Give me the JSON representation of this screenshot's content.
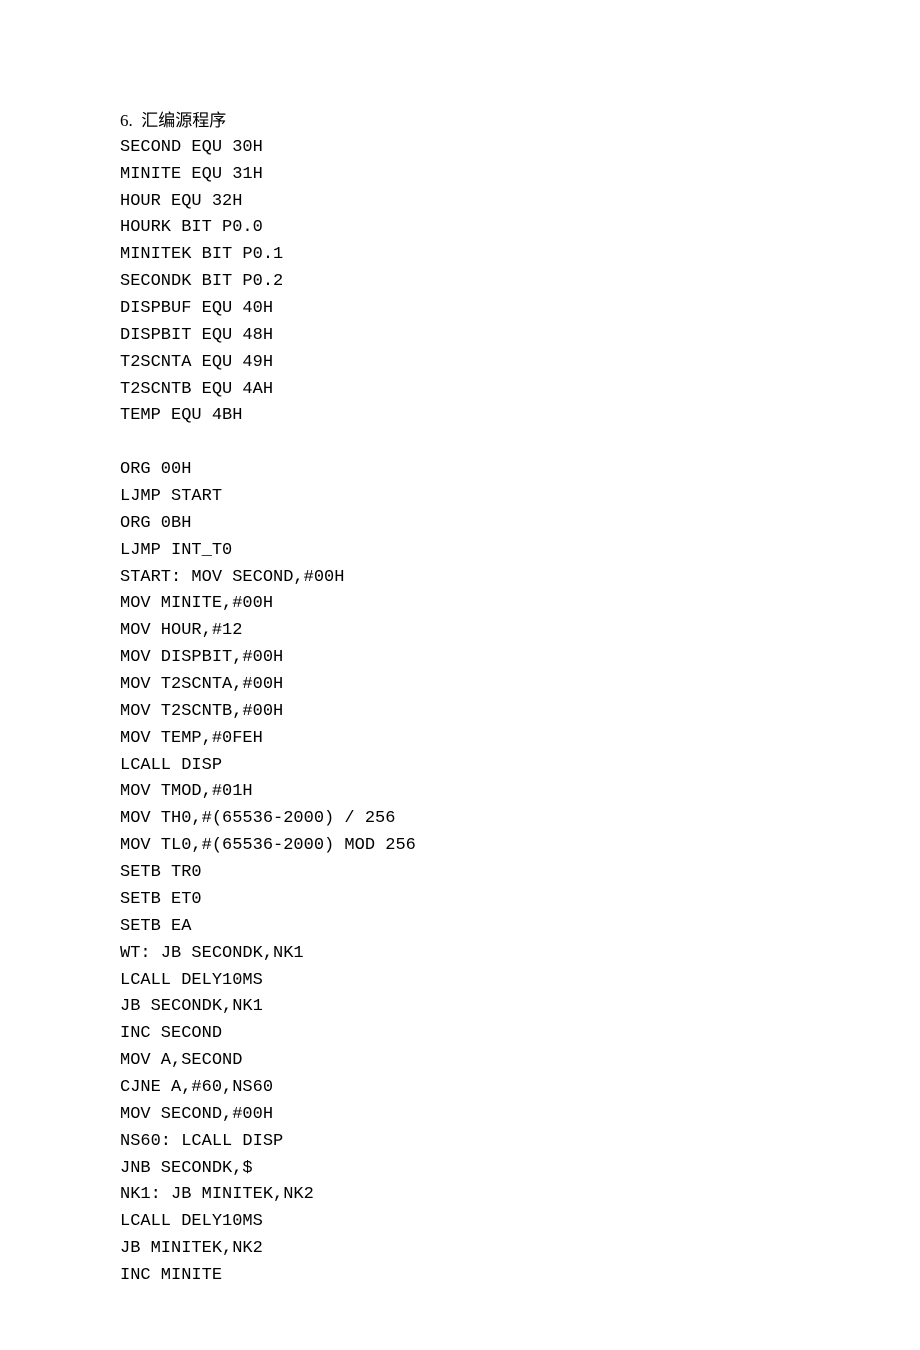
{
  "heading": "6.  汇编源程序",
  "lines": [
    "SECOND EQU 30H",
    "MINITE EQU 31H",
    "HOUR EQU 32H",
    "HOURK BIT P0.0",
    "MINITEK BIT P0.1",
    "SECONDK BIT P0.2",
    "DISPBUF EQU 40H",
    "DISPBIT EQU 48H",
    "T2SCNTA EQU 49H",
    "T2SCNTB EQU 4AH",
    "TEMP EQU 4BH",
    "",
    "ORG 00H",
    "LJMP START",
    "ORG 0BH",
    "LJMP INT_T0",
    "START: MOV SECOND,#00H",
    "MOV MINITE,#00H",
    "MOV HOUR,#12",
    "MOV DISPBIT,#00H",
    "MOV T2SCNTA,#00H",
    "MOV T2SCNTB,#00H",
    "MOV TEMP,#0FEH",
    "LCALL DISP",
    "MOV TMOD,#01H",
    "MOV TH0,#(65536-2000) / 256",
    "MOV TL0,#(65536-2000) MOD 256",
    "SETB TR0",
    "SETB ET0",
    "SETB EA",
    "WT: JB SECONDK,NK1",
    "LCALL DELY10MS",
    "JB SECONDK,NK1",
    "INC SECOND",
    "MOV A,SECOND",
    "CJNE A,#60,NS60",
    "MOV SECOND,#00H",
    "NS60: LCALL DISP",
    "JNB SECONDK,$",
    "NK1: JB MINITEK,NK2",
    "LCALL DELY10MS",
    "JB MINITEK,NK2",
    "INC MINITE"
  ]
}
